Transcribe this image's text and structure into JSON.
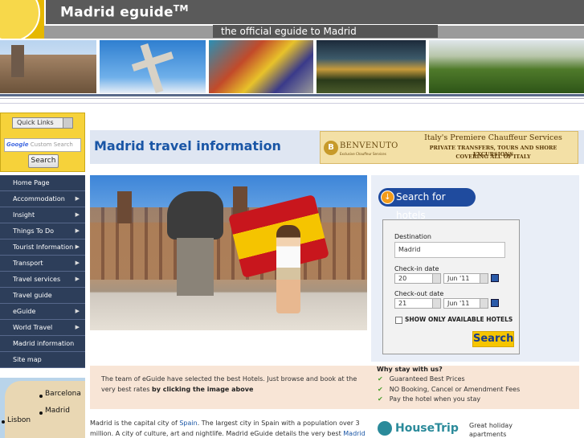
{
  "header": {
    "site_title": "Madrid eguide",
    "trademark": "TM",
    "tagline": "the official eguide to Madrid"
  },
  "sidebar": {
    "quick_links": "Quick Links",
    "search_placeholder_brand": "Google",
    "search_placeholder": "Custom Search",
    "search_button": "Search",
    "nav": [
      {
        "label": "Home Page",
        "has_children": false
      },
      {
        "label": "Accommodation",
        "has_children": true
      },
      {
        "label": "Insight",
        "has_children": true
      },
      {
        "label": "Things To Do",
        "has_children": true
      },
      {
        "label": "Tourist Information",
        "has_children": true
      },
      {
        "label": "Transport",
        "has_children": true
      },
      {
        "label": "Travel services",
        "has_children": true
      },
      {
        "label": "Travel guide",
        "has_children": false
      },
      {
        "label": "eGuide",
        "has_children": true
      },
      {
        "label": "World Travel",
        "has_children": true
      },
      {
        "label": "Madrid information",
        "has_children": false
      },
      {
        "label": "Site map",
        "has_children": false
      }
    ],
    "map": {
      "city1": "Barcelona",
      "city2": "Madrid",
      "city3": "Lisbon"
    }
  },
  "main": {
    "page_title": "Madrid travel information",
    "ad": {
      "brand": "BENVENUTO",
      "brand_sub": "Exclusive Chauffeur Services",
      "headline": "Italy's Premiere Chauffeur Services",
      "line2": "PRIVATE TRANSFERS, TOURS AND SHORE EXCURSIONS",
      "line3": "COVERING ALL OF ITALY"
    },
    "hotel": {
      "search_for_hotels": "Search for hotels",
      "destination_label": "Destination",
      "destination_value": "Madrid",
      "checkin_label": "Check-in date",
      "checkin_day": "20",
      "checkin_month": "Jun '11",
      "checkout_label": "Check-out date",
      "checkout_day": "21",
      "checkout_month": "Jun '11",
      "available_only": "SHOW ONLY AVAILABLE HOTELS",
      "search_button": "Search"
    },
    "info_left_1": "The team of eGuide have selected the best Hotels. Just browse and book at the very best rates ",
    "info_left_bold": "by clicking the image above",
    "why_title": "Why stay with us?",
    "why_items": [
      "Guaranteed Best Prices",
      "NO Booking, Cancel or Amendment  Fees",
      "Pay the hotel when you stay"
    ],
    "intro_1": "Madrid is the capital city of ",
    "intro_link1": "Spain",
    "intro_2": ". The largest city in Spain with a population over 3 million. A city of culture, art and nightlife. Madrid eGuide details the very best ",
    "intro_link2": "Madrid accommodation",
    "intro_3": ",",
    "housetrip_brand": "HouseTrip",
    "housetrip_text1": "Great holiday",
    "housetrip_text2": "apartments"
  },
  "colors": {
    "nav_bg": "#2d3e5a",
    "title_blue": "#1a56a6",
    "search_yellow": "#f6d23a",
    "hotel_button": "#1f4b9e"
  }
}
